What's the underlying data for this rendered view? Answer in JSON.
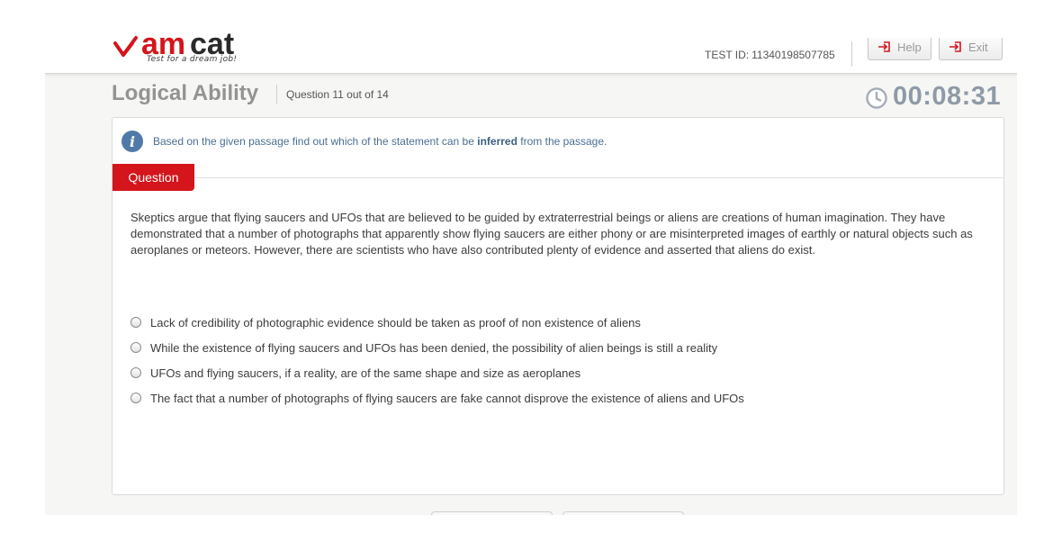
{
  "header": {
    "logo_tagline": "Test for a dream job!",
    "logo_text": "amcat",
    "test_id_label": "TEST ID:",
    "test_id_value": "11340198507785",
    "help_label": "Help",
    "exit_label": "Exit"
  },
  "section": {
    "title": "Logical Ability",
    "counter": "Question 11 out of 14"
  },
  "timer": {
    "value": "00:08:31",
    "icon": "clock-icon"
  },
  "instruction": {
    "icon": "info-icon",
    "before": "Based on the given passage find out which of the statement can be",
    "emphasis": "inferred",
    "after": "from the passage."
  },
  "question_tab_label": "Question",
  "passage": "Skeptics argue that flying saucers and UFOs that are believed to be guided by extraterrestrial beings or aliens are creations of human imagination. They have demonstrated that a number of photographs that apparently show flying saucers are either phony or are misinterpreted images of earthly or natural objects such as aeroplanes or meteors. However, there are scientists who have also contributed plenty of evidence and asserted that aliens do exist.",
  "options": [
    "Lack of credibility of photographic evidence should be taken as proof of non existence of aliens",
    "While the existence of flying saucers and UFOs has been denied, the possibility of alien beings is still a reality",
    "UFOs and flying saucers, if a reality, are of the same shape and size as aeroplanes",
    "The fact that a number of photographs of flying saucers are fake cannot disprove the existence of aliens and UFOs"
  ],
  "colors": {
    "accent_red": "#d4151c",
    "info_blue": "#4f7aa8",
    "timer_gray": "#8f9aa8",
    "title_gray": "#939393"
  }
}
